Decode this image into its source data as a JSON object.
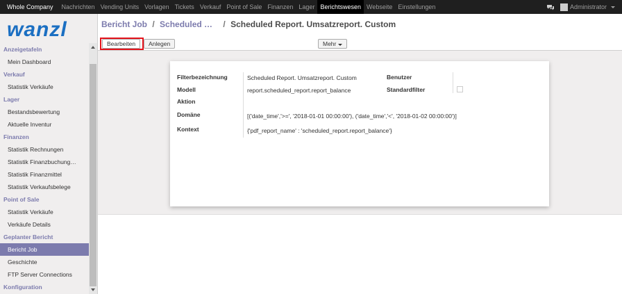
{
  "topbar": {
    "company": "Whole Company",
    "menu": [
      "Nachrichten",
      "Vending Units",
      "Vorlagen",
      "Tickets",
      "Verkauf",
      "Point of Sale",
      "Finanzen",
      "Lager",
      "Berichtswesen",
      "Webseite",
      "Einstellungen"
    ],
    "active_index": 8,
    "user": "Administrator"
  },
  "logo": {
    "text": "wanzl",
    "color": "#1b6fc2"
  },
  "sidebar": {
    "sections": [
      {
        "title": "Anzeigetafeln",
        "items": [
          "Mein Dashboard"
        ]
      },
      {
        "title": "Verkauf",
        "items": [
          "Statistik Verkäufe"
        ]
      },
      {
        "title": "Lager",
        "items": [
          "Bestandsbewertung",
          "Aktuelle Inventur"
        ]
      },
      {
        "title": "Finanzen",
        "items": [
          "Statistik Rechnungen",
          "Statistik Finanzbuchung…",
          "Statistik Finanzmittel",
          "Statistik Verkaufsbelege"
        ]
      },
      {
        "title": "Point of Sale",
        "items": [
          "Statistik Verkäufe",
          "Verkäufe Details"
        ]
      },
      {
        "title": "Geplanter Bericht",
        "items": [
          "Bericht Job",
          "Geschichte",
          "FTP Server Connections"
        ]
      },
      {
        "title": "Konfiguration",
        "items": []
      }
    ],
    "active_item": "Bericht Job"
  },
  "breadcrumb": {
    "parent": "Bericht Job",
    "sep": "/",
    "middle": "Scheduled …",
    "current": "Scheduled Report. Umsatzreport. Custom"
  },
  "buttons": {
    "edit": "Bearbeiten",
    "create": "Anlegen",
    "more": "Mehr"
  },
  "form": {
    "filter_name_label": "Filterbezeichnung",
    "filter_name_value": "Scheduled Report. Umsatzreport. Custom",
    "model_label": "Modell",
    "model_value": "report.scheduled_report.report_balance",
    "action_label": "Aktion",
    "domain_label": "Domäne",
    "domain_value": "[('date_time','>=', '2018-01-01 00:00:00'), ('date_time','<', '2018-01-02 00:00:00')]",
    "context_label": "Kontext",
    "context_value": "{'pdf_report_name' : 'scheduled_report.report_balance'}",
    "user_label": "Benutzer",
    "default_filter_label": "Standardfilter"
  },
  "colors": {
    "accent": "#7c7bad",
    "highlight": "#e4131b",
    "topbar": "#1f1f1f"
  }
}
